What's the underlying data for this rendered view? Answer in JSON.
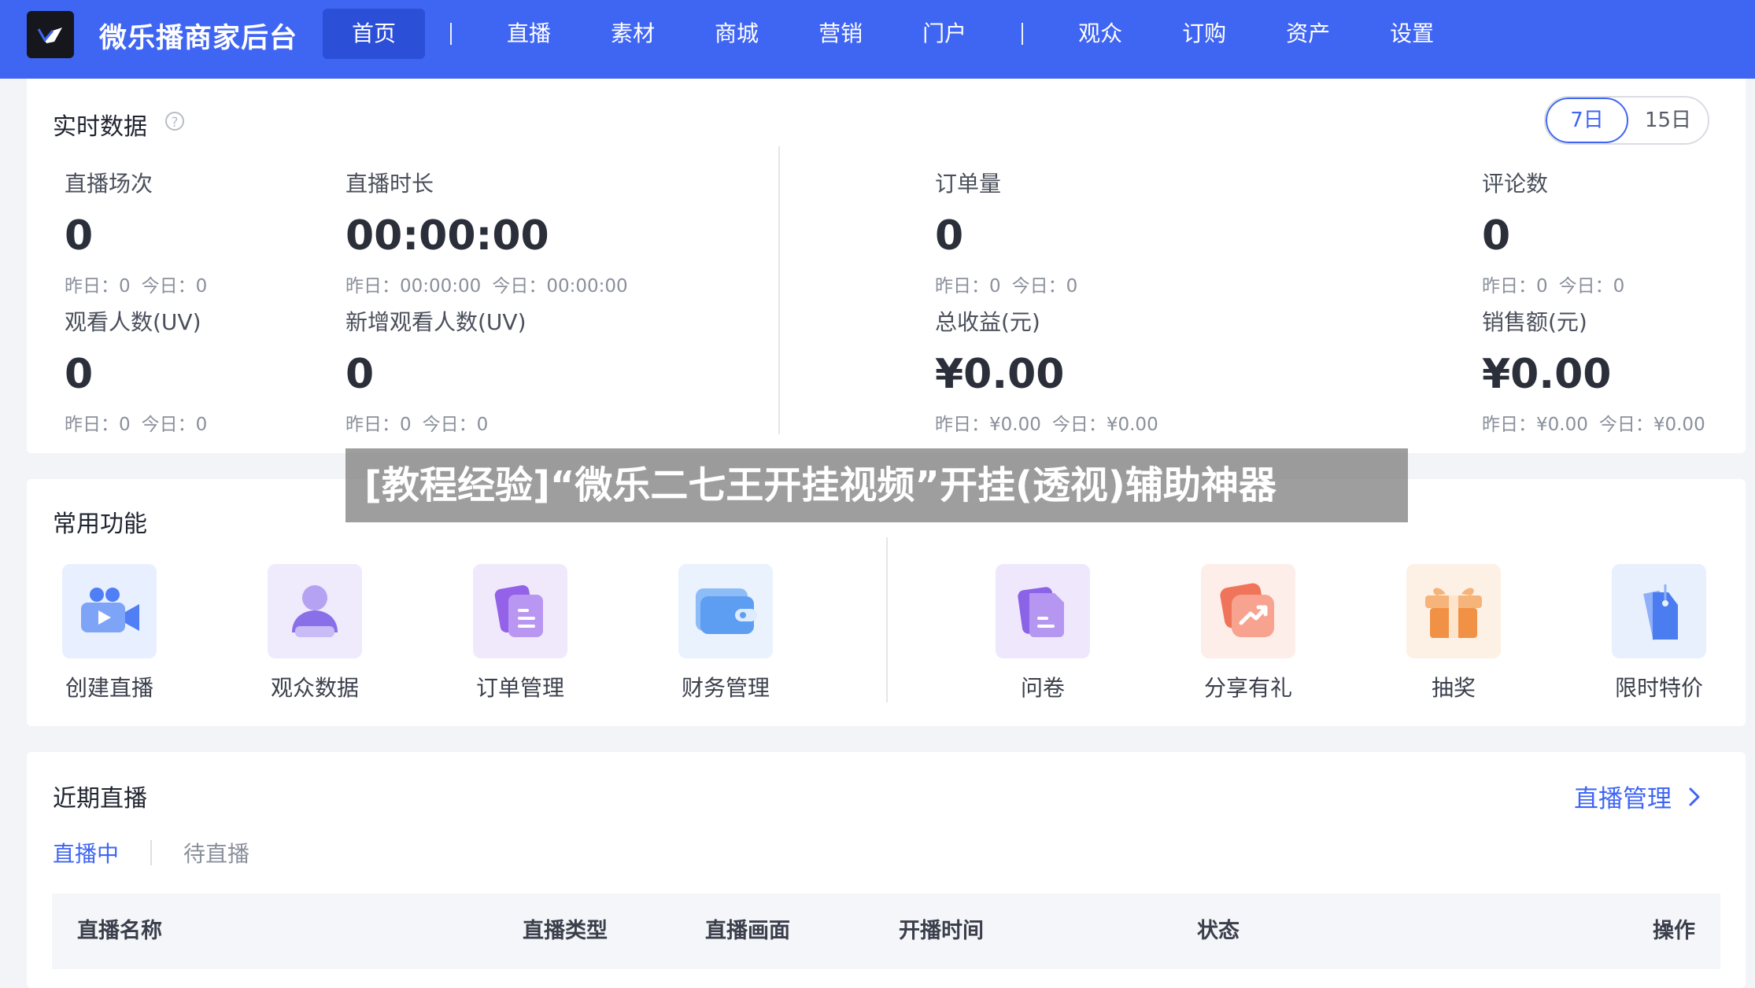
{
  "app": {
    "brand": "微乐播商家后台"
  },
  "nav": {
    "items": [
      {
        "label": "首页",
        "active": true
      },
      {
        "label": "直播"
      },
      {
        "label": "素材"
      },
      {
        "label": "商城"
      },
      {
        "label": "营销"
      },
      {
        "label": "门户"
      },
      {
        "label": "观众"
      },
      {
        "label": "订购"
      },
      {
        "label": "资产"
      },
      {
        "label": "设置"
      }
    ]
  },
  "realtime": {
    "title": "实时数据",
    "help_glyph": "?",
    "ranges": [
      {
        "label": "7日",
        "active": true
      },
      {
        "label": "15日"
      }
    ],
    "stats": [
      {
        "label": "直播场次",
        "value": "0",
        "yesterday": "昨日：0",
        "today": "今日：0"
      },
      {
        "label": "直播时长",
        "value": "00:00:00",
        "yesterday": "昨日：00:00:00",
        "today": "今日：00:00:00"
      },
      {
        "label": "订单量",
        "value": "0",
        "yesterday": "昨日：0",
        "today": "今日：0"
      },
      {
        "label": "评论数",
        "value": "0",
        "yesterday": "昨日：0",
        "today": "今日：0"
      },
      {
        "label": "观看人数(UV)",
        "value": "0",
        "yesterday": "昨日：0",
        "today": "今日：0"
      },
      {
        "label": "新增观看人数(UV)",
        "value": "0",
        "yesterday": "昨日：0",
        "today": "今日：0"
      },
      {
        "label": "总收益(元)",
        "value": "¥0.00",
        "yesterday": "昨日：¥0.00",
        "today": "今日：¥0.00"
      },
      {
        "label": "销售额(元)",
        "value": "¥0.00",
        "yesterday": "昨日：¥0.00",
        "today": "今日：¥0.00"
      }
    ]
  },
  "common": {
    "title": "常用功能",
    "items": [
      {
        "label": "创建直播",
        "icon": "video-camera-icon",
        "bg": "#e8effe",
        "color": "#4f7ef5"
      },
      {
        "label": "观众数据",
        "icon": "audience-icon",
        "bg": "#efeafc",
        "color": "#8a70e8"
      },
      {
        "label": "订单管理",
        "icon": "order-doc-icon",
        "bg": "#f0e9fc",
        "color": "#9462e8"
      },
      {
        "label": "财务管理",
        "icon": "wallet-icon",
        "bg": "#eaf2fd",
        "color": "#5d9ef2"
      },
      {
        "label": "问卷",
        "icon": "survey-icon",
        "bg": "#efe8fc",
        "color": "#8b63e6"
      },
      {
        "label": "分享有礼",
        "icon": "share-trend-icon",
        "bg": "#fdeee9",
        "color": "#f0745a"
      },
      {
        "label": "抽奖",
        "icon": "gift-box-icon",
        "bg": "#fdf1e6",
        "color": "#f19145"
      },
      {
        "label": "限时特价",
        "icon": "price-tag-icon",
        "bg": "#e9f0fd",
        "color": "#4b7cf0"
      }
    ]
  },
  "recent": {
    "title": "近期直播",
    "manage_label": "直播管理",
    "tabs": [
      {
        "label": "直播中",
        "active": true
      },
      {
        "label": "待直播"
      }
    ],
    "columns": [
      "直播名称",
      "直播类型",
      "直播画面",
      "开播时间",
      "状态",
      "操作"
    ]
  },
  "banner": {
    "text": "[教程经验]“微乐二七王开挂视频”开挂(透视)辅助神器"
  },
  "colors": {
    "primary": "#3f65f3",
    "nav_active": "#2c4fd8"
  }
}
